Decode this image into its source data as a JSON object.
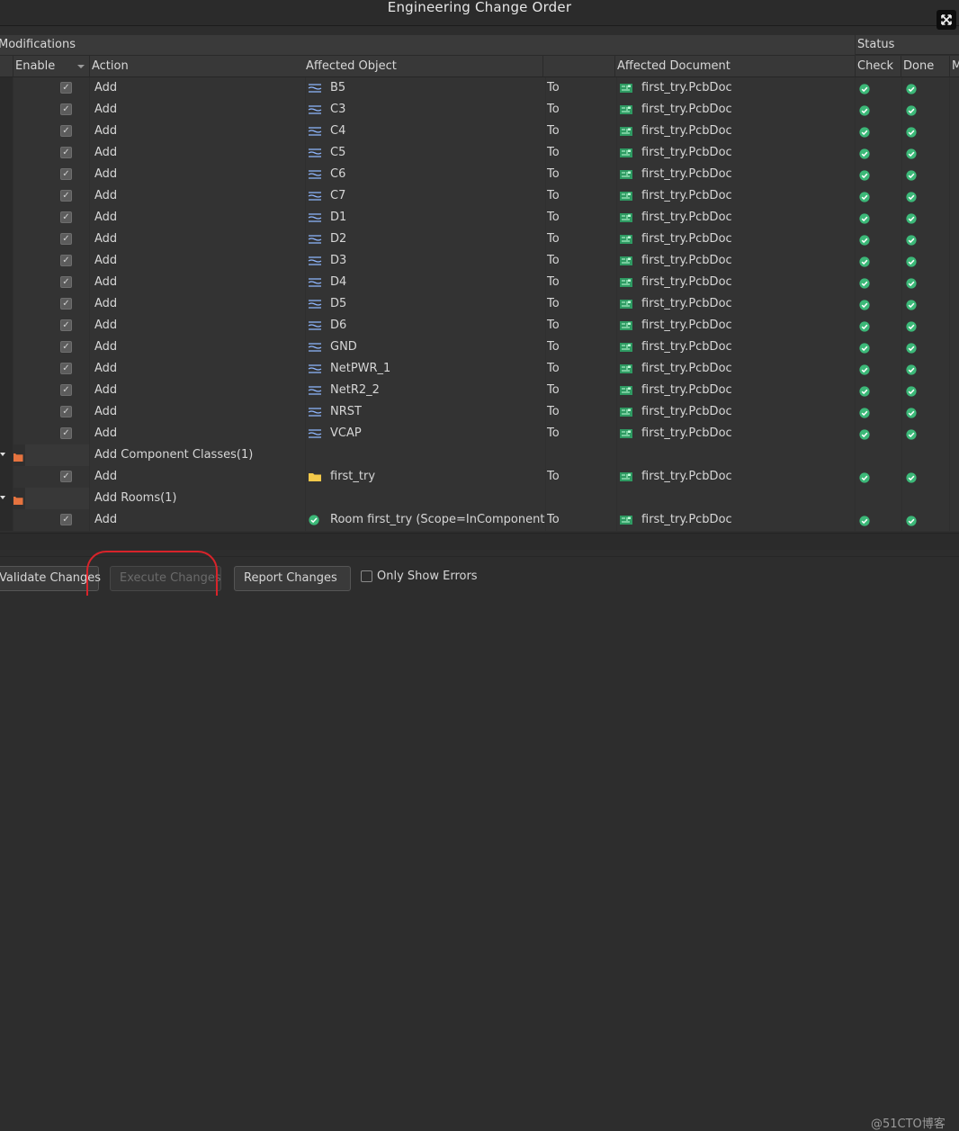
{
  "window": {
    "title": "Engineering Change Order"
  },
  "sections": {
    "modifications": "Modifications",
    "status": "Status"
  },
  "columns": {
    "enable": "Enable",
    "action": "Action",
    "affected_object": "Affected Object",
    "affected_document": "Affected Document",
    "check": "Check",
    "done": "Done",
    "message": "M"
  },
  "rows": [
    {
      "kind": "item",
      "action": "Add",
      "object": "B5",
      "object_icon": "net-icon",
      "to": "To",
      "document": "first_try.PcbDoc",
      "check": "ok",
      "done": "ok"
    },
    {
      "kind": "item",
      "action": "Add",
      "object": "C3",
      "object_icon": "net-icon",
      "to": "To",
      "document": "first_try.PcbDoc",
      "check": "ok",
      "done": "ok"
    },
    {
      "kind": "item",
      "action": "Add",
      "object": "C4",
      "object_icon": "net-icon",
      "to": "To",
      "document": "first_try.PcbDoc",
      "check": "ok",
      "done": "ok"
    },
    {
      "kind": "item",
      "action": "Add",
      "object": "C5",
      "object_icon": "net-icon",
      "to": "To",
      "document": "first_try.PcbDoc",
      "check": "ok",
      "done": "ok"
    },
    {
      "kind": "item",
      "action": "Add",
      "object": "C6",
      "object_icon": "net-icon",
      "to": "To",
      "document": "first_try.PcbDoc",
      "check": "ok",
      "done": "ok"
    },
    {
      "kind": "item",
      "action": "Add",
      "object": "C7",
      "object_icon": "net-icon",
      "to": "To",
      "document": "first_try.PcbDoc",
      "check": "ok",
      "done": "ok"
    },
    {
      "kind": "item",
      "action": "Add",
      "object": "D1",
      "object_icon": "net-icon",
      "to": "To",
      "document": "first_try.PcbDoc",
      "check": "ok",
      "done": "ok"
    },
    {
      "kind": "item",
      "action": "Add",
      "object": "D2",
      "object_icon": "net-icon",
      "to": "To",
      "document": "first_try.PcbDoc",
      "check": "ok",
      "done": "ok"
    },
    {
      "kind": "item",
      "action": "Add",
      "object": "D3",
      "object_icon": "net-icon",
      "to": "To",
      "document": "first_try.PcbDoc",
      "check": "ok",
      "done": "ok"
    },
    {
      "kind": "item",
      "action": "Add",
      "object": "D4",
      "object_icon": "net-icon",
      "to": "To",
      "document": "first_try.PcbDoc",
      "check": "ok",
      "done": "ok"
    },
    {
      "kind": "item",
      "action": "Add",
      "object": "D5",
      "object_icon": "net-icon",
      "to": "To",
      "document": "first_try.PcbDoc",
      "check": "ok",
      "done": "ok"
    },
    {
      "kind": "item",
      "action": "Add",
      "object": "D6",
      "object_icon": "net-icon",
      "to": "To",
      "document": "first_try.PcbDoc",
      "check": "ok",
      "done": "ok"
    },
    {
      "kind": "item",
      "action": "Add",
      "object": "GND",
      "object_icon": "net-icon",
      "to": "To",
      "document": "first_try.PcbDoc",
      "check": "ok",
      "done": "ok"
    },
    {
      "kind": "item",
      "action": "Add",
      "object": "NetPWR_1",
      "object_icon": "net-icon",
      "to": "To",
      "document": "first_try.PcbDoc",
      "check": "ok",
      "done": "ok"
    },
    {
      "kind": "item",
      "action": "Add",
      "object": "NetR2_2",
      "object_icon": "net-icon",
      "to": "To",
      "document": "first_try.PcbDoc",
      "check": "ok",
      "done": "ok"
    },
    {
      "kind": "item",
      "action": "Add",
      "object": "NRST",
      "object_icon": "net-icon",
      "to": "To",
      "document": "first_try.PcbDoc",
      "check": "ok",
      "done": "ok"
    },
    {
      "kind": "item",
      "action": "Add",
      "object": "VCAP",
      "object_icon": "net-icon",
      "to": "To",
      "document": "first_try.PcbDoc",
      "check": "ok",
      "done": "ok"
    },
    {
      "kind": "group",
      "label": "Add Component Classes(1)"
    },
    {
      "kind": "item",
      "action": "Add",
      "object": "first_try",
      "object_icon": "folder-icon",
      "to": "To",
      "document": "first_try.PcbDoc",
      "check": "ok",
      "done": "ok"
    },
    {
      "kind": "group",
      "label": "Add Rooms(1)"
    },
    {
      "kind": "item",
      "action": "Add",
      "object": "Room first_try (Scope=InComponentCl",
      "object_icon": "room-check-icon",
      "to": "To",
      "document": "first_try.PcbDoc",
      "check": "ok",
      "done": "ok"
    }
  ],
  "buttons": {
    "validate": "Validate Changes",
    "execute": "Execute Changes",
    "report": "Report Changes",
    "only_show_errors": "Only Show Errors"
  },
  "watermark": "@51CTO博客",
  "colors": {
    "accent_ok": "#3cb878",
    "highlight": "#d8232a"
  }
}
